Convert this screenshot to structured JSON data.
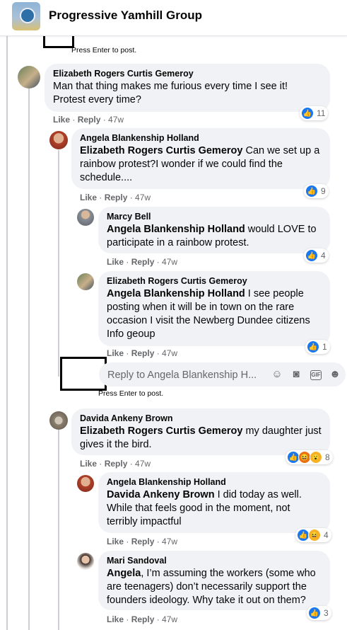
{
  "header": {
    "group_name": "Progressive Yamhill Group"
  },
  "hints": {
    "top": "Press Enter to post.",
    "mid": "Press Enter to post."
  },
  "reply_box": {
    "placeholder": "Reply to Angela Blankenship H..."
  },
  "comments": [
    {
      "author": "Elizabeth Rogers Curtis Gemeroy",
      "mention": "",
      "text": "Man that thing makes me furious every time I see it! Protest every time?",
      "like": "Like",
      "reply": "Reply",
      "time": "47w",
      "reactions": "11"
    },
    {
      "author": "Angela Blankenship Holland",
      "mention": "Elizabeth Rogers Curtis Gemeroy",
      "text": " Can we set up a rainbow protest?I wonder if we could find the schedule....",
      "like": "Like",
      "reply": "Reply",
      "time": "47w",
      "reactions": "9"
    },
    {
      "author": "Marcy Bell",
      "mention": "Angela Blankenship Holland",
      "text": " would LOVE to participate in a rainbow protest.",
      "like": "Like",
      "reply": "Reply",
      "time": "47w",
      "reactions": "4"
    },
    {
      "author": "Elizabeth Rogers Curtis Gemeroy",
      "mention": "Angela Blankenship Holland",
      "text": " I see people posting when it will be in town on the rare occasion I visit the Newberg Dundee citizens Info geoup",
      "like": "Like",
      "reply": "Reply",
      "time": "47w",
      "reactions": "1"
    },
    {
      "author": "Davida Ankeny Brown",
      "mention": "Elizabeth Rogers Curtis Gemeroy",
      "text": " my daughter just gives it the bird.",
      "like": "Like",
      "reply": "Reply",
      "time": "47w",
      "reactions": "8"
    },
    {
      "author": "Angela Blankenship Holland",
      "mention": "Davida Ankeny Brown",
      "text": " I did today as well. While that feels good in the moment, not terribly impactful",
      "like": "Like",
      "reply": "Reply",
      "time": "47w",
      "reactions": "4"
    },
    {
      "author": "Mari Sandoval",
      "mention": "Angela",
      "text": ", I’m assuming the workers (some who are teenagers) don’t necessarily support the founders ideology. Why take it out on them?",
      "like": "Like",
      "reply": "Reply",
      "time": "47w",
      "reactions": "3"
    }
  ],
  "colors": {
    "like_blue": "#1877f2",
    "bubble_bg": "#f0f2f5",
    "meta_gray": "#65676b"
  }
}
